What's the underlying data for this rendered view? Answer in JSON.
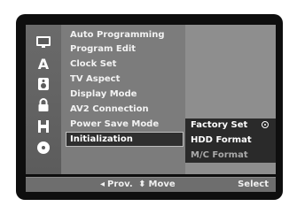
{
  "menu": {
    "items": [
      {
        "label": "Auto Programming"
      },
      {
        "label": "Program Edit"
      },
      {
        "label": "Clock Set"
      },
      {
        "label": "TV Aspect"
      },
      {
        "label": "Display Mode"
      },
      {
        "label": "AV2 Connection"
      },
      {
        "label": "Power Save Mode"
      },
      {
        "label": "Initialization",
        "selected": true
      }
    ]
  },
  "submenu": {
    "items": [
      {
        "label": "Factory Set",
        "enabled": true,
        "has_radio": true
      },
      {
        "label": "HDD Format",
        "enabled": true
      },
      {
        "label": "M/C Format",
        "enabled": false
      }
    ]
  },
  "sidebar": {
    "icons": [
      {
        "name": "setup-icon"
      },
      {
        "name": "language-icon",
        "glyph": "A"
      },
      {
        "name": "audio-icon"
      },
      {
        "name": "lock-icon"
      },
      {
        "name": "recording-icon"
      },
      {
        "name": "disc-icon"
      }
    ]
  },
  "footer": {
    "prev_arrow": "◂",
    "prev_label": "Prov.",
    "move_arrows": "⬍",
    "move_label": "Move",
    "select_label": "Select"
  },
  "colors": {
    "panel": "#5a5a5a",
    "menu_bg": "#7c7c7c",
    "submenu_bg": "#8e8e8e",
    "selection": "#2f2f2f"
  }
}
